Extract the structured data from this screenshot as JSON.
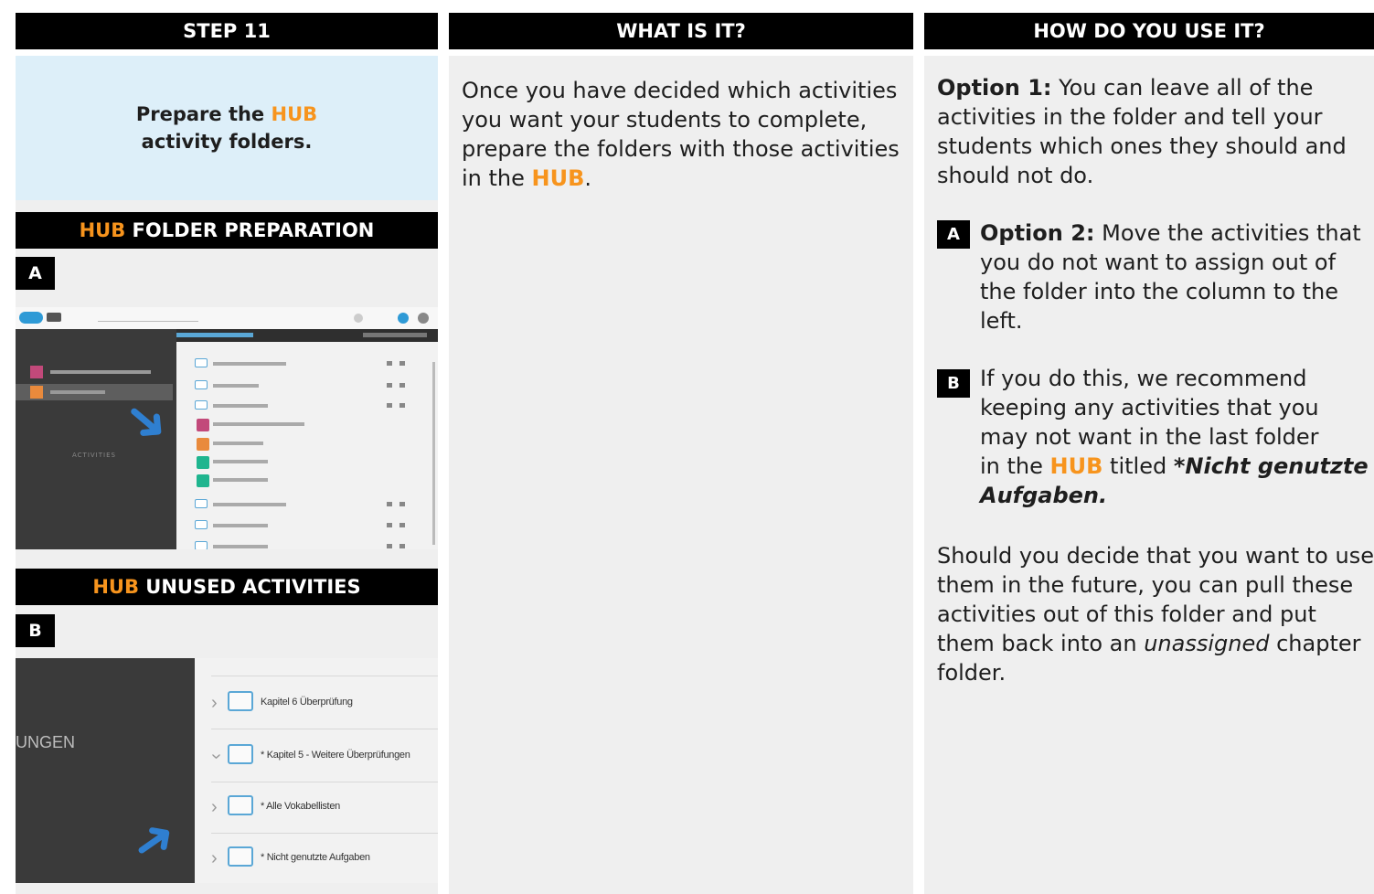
{
  "col1": {
    "header": "STEP 11",
    "title_pre": "Prepare the ",
    "title_hub": "HUB",
    "title_post": "activity folders.",
    "sub1_hub": "HUB",
    "sub1_rest": " FOLDER PREPARATION",
    "tag_a": "A",
    "sub2_hub": "HUB",
    "sub2_rest": " UNUSED ACTIVITIES",
    "tag_b": "B",
    "shot_b": {
      "side_text": "UNGEN",
      "rows": [
        "Kapitel 6 Überprüfung",
        "* Kapitel 5 - Weitere Überprüfungen",
        "* Alle Vokabellisten",
        "* Nicht genutzte Aufgaben"
      ]
    }
  },
  "col2": {
    "header": "WHAT IS IT?",
    "lines": [
      "Once you have decided which activities",
      "you want your students to complete,",
      "prepare the folders with those activities"
    ],
    "last_pre": "in the ",
    "last_hub": "HUB",
    "last_post": "."
  },
  "col3": {
    "header": "HOW DO YOU USE IT?",
    "opt1_label": "Option 1:",
    "opt1_lines": [
      " You can leave all of the",
      "activities in the folder and tell your",
      "students which ones they should and",
      "should not do."
    ],
    "tag_a": "A",
    "opt2_label": "Option 2:",
    "opt2_lines": [
      " Move the activities that",
      "you do not want to assign out of",
      "the folder into the column to the",
      "left."
    ],
    "tag_b": "B",
    "b_lines": [
      "If you do this, we recommend",
      "keeping any activities that you",
      "may not want in the last folder"
    ],
    "b_last_pre": "in the ",
    "b_last_hub": "HUB",
    "b_last_mid": " titled ",
    "b_last_em": "*Nicht genutzte",
    "b_last_em2": "Aufgaben.",
    "final_lines": [
      "Should you decide that you want to use",
      "them in the future, you can pull these",
      "activities out of this folder and put"
    ],
    "final_l4_pre": "them back into an ",
    "final_l4_em": "unassigned",
    "final_l4_post": " chapter",
    "final_l5": "folder."
  },
  "colors": {
    "accent": "#f7941d",
    "header_bg": "#000000",
    "panel_bg": "#efefef",
    "title_box_bg": "#ddeff9"
  }
}
